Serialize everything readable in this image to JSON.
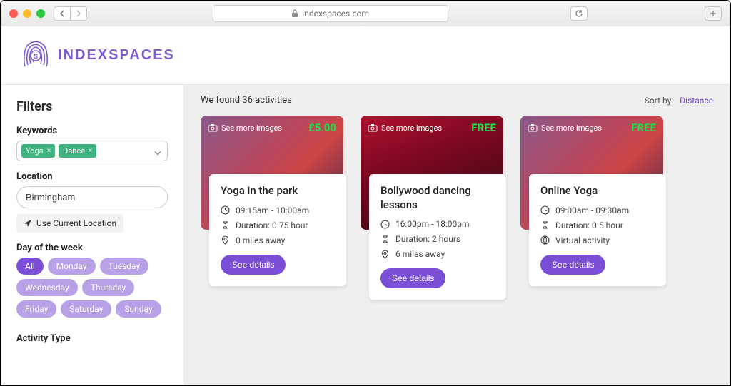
{
  "browser": {
    "url": "indexspaces.com"
  },
  "brand": "INDEXSPACES",
  "filters": {
    "title": "Filters",
    "keywords_label": "Keywords",
    "keywords": [
      {
        "label": "Yoga"
      },
      {
        "label": "Dance"
      }
    ],
    "location_label": "Location",
    "location_value": "Birmingham",
    "use_current_loc": "Use Current Location",
    "dow_label": "Day of the week",
    "days": [
      {
        "label": "All",
        "active": true
      },
      {
        "label": "Monday"
      },
      {
        "label": "Tuesday"
      },
      {
        "label": "Wednesday"
      },
      {
        "label": "Thursday"
      },
      {
        "label": "Friday"
      },
      {
        "label": "Saturday"
      },
      {
        "label": "Sunday"
      }
    ],
    "activity_type_label": "Activity Type"
  },
  "results": {
    "found_text": "We found 36 activities",
    "sort_label": "Sort by:",
    "sort_value": "Distance",
    "see_more_label": "See more images",
    "details_label": "See details",
    "cards": [
      {
        "price": "£5.00",
        "title": "Yoga in the park",
        "time": "09:15am - 10:00am",
        "duration": "Duration: 0.75 hour",
        "distance": "0 miles away",
        "virtual": false
      },
      {
        "price": "FREE",
        "title": "Bollywood dancing lessons",
        "time": "16:00pm - 18:00pm",
        "duration": "Duration: 2 hours",
        "distance": "6 miles away",
        "virtual": false
      },
      {
        "price": "FREE",
        "title": "Online Yoga",
        "time": "09:00am - 09:30am",
        "duration": "Duration: 0.5 hour",
        "distance": "Virtual activity",
        "virtual": true
      }
    ]
  }
}
